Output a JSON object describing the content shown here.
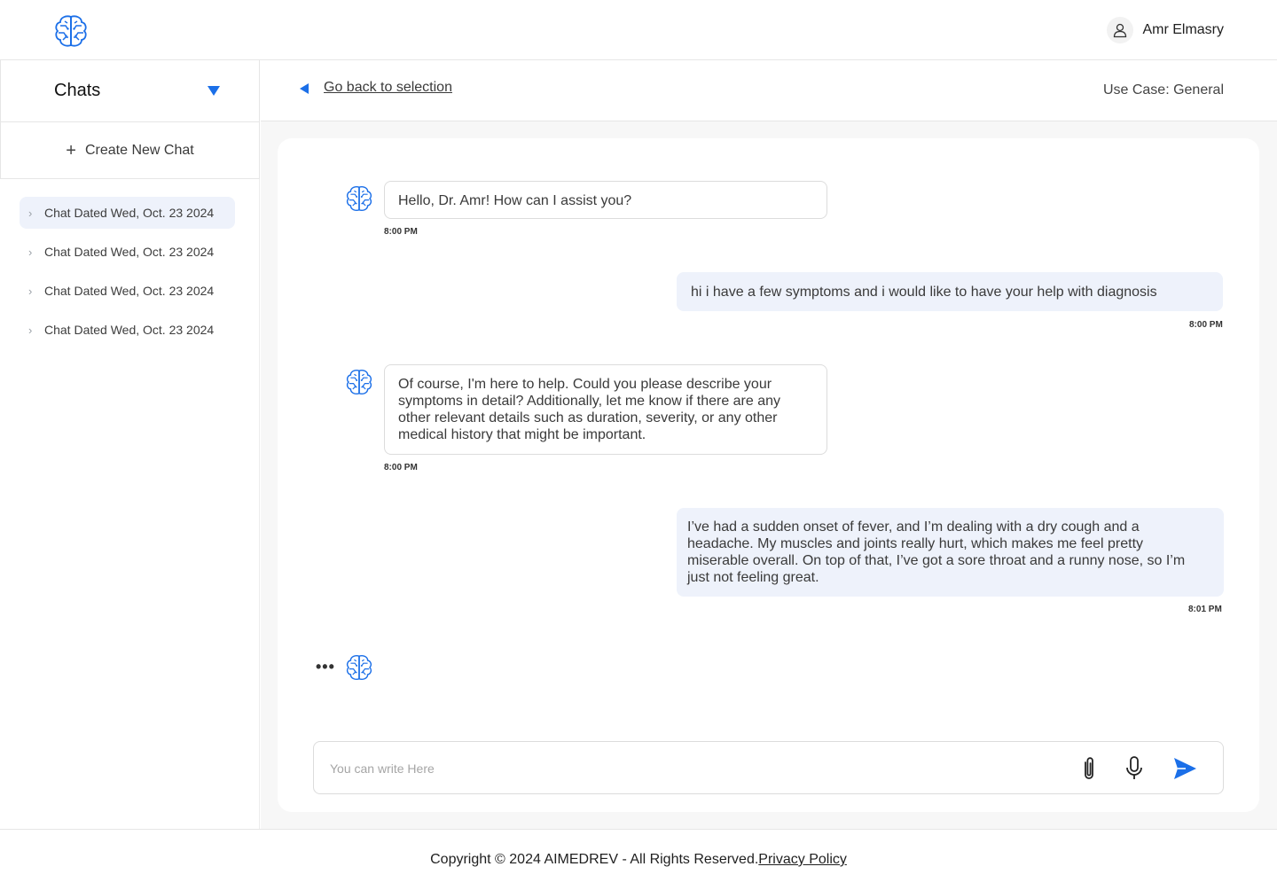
{
  "header": {
    "logo_icon": "brain-logo-icon",
    "user_icon": "user-icon",
    "user_name": "Amr Elmasry"
  },
  "sidebar": {
    "title": "Chats",
    "caret_icon": "caret-down-icon",
    "create_label": "Create New Chat",
    "items": [
      {
        "label": "Chat Dated Wed, Oct. 23 2024",
        "active": true
      },
      {
        "label": "Chat Dated Wed, Oct. 23 2024",
        "active": false
      },
      {
        "label": "Chat Dated Wed, Oct. 23 2024",
        "active": false
      },
      {
        "label": "Chat Dated Wed, Oct. 23 2024",
        "active": false
      }
    ]
  },
  "topbar": {
    "back_label": "Go back to selection",
    "use_case": "Use Case: General"
  },
  "messages": [
    {
      "sender": "bot",
      "text": "Hello, Dr. Amr! How can I assist you?",
      "time": "8:00 PM"
    },
    {
      "sender": "user",
      "text": "hi i have a few symptoms and i would like to have your help with diagnosis",
      "time": "8:00 PM"
    },
    {
      "sender": "bot",
      "text": "Of course, I'm here to help. Could you please describe your symptoms in detail? Additionally, let me know if there are any other relevant details such as duration, severity, or any other medical history that might be important.",
      "time": "8:00 PM"
    },
    {
      "sender": "user",
      "text": "I’ve had a sudden onset of fever, and I’m dealing with a dry cough and a headache. My muscles and joints really hurt, which makes me feel pretty miserable overall. On top of that, I’ve got a sore throat and a runny nose, so I’m just not feeling great.",
      "time": "8:01 PM"
    }
  ],
  "typing_indicator": "•••",
  "composer": {
    "placeholder": "You can write Here",
    "value": "",
    "attach_icon": "paperclip-icon",
    "mic_icon": "microphone-icon",
    "send_icon": "send-icon"
  },
  "footer": {
    "copyright": "Copyright © 2024 AIMEDREV - All Rights Reserved.",
    "privacy_label": "Privacy Policy"
  },
  "colors": {
    "accent": "#1b6fe8",
    "user_bubble": "#eef2fb",
    "border": "#dcdcdc",
    "main_bg": "#f7f7f7"
  }
}
